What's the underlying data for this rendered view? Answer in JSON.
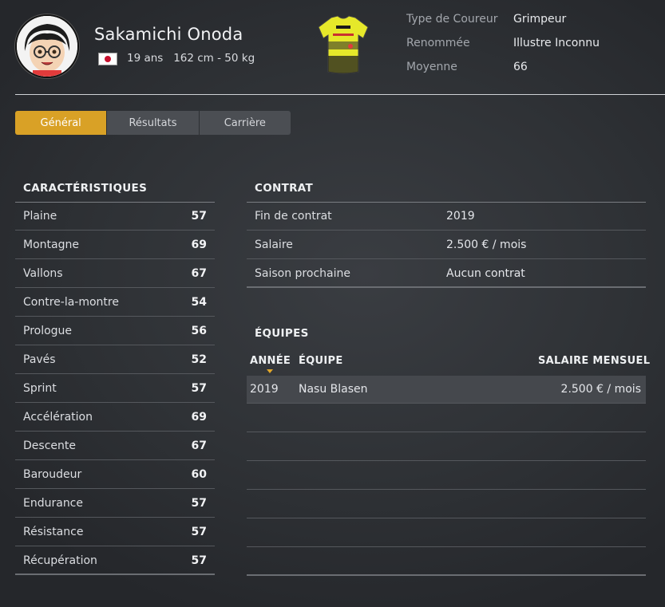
{
  "player": {
    "name": "Sakamichi Onoda",
    "age_height_weight": "19 ans   162 cm - 50 kg",
    "flag_icon": "japan-flag-icon"
  },
  "info": [
    {
      "label": "Type de Coureur",
      "value": "Grimpeur"
    },
    {
      "label": "Renommée",
      "value": "Illustre Inconnu"
    },
    {
      "label": "Moyenne",
      "value": "66"
    }
  ],
  "tabs": [
    {
      "label": "Général",
      "active": true
    },
    {
      "label": "Résultats",
      "active": false
    },
    {
      "label": "Carrière",
      "active": false
    }
  ],
  "characteristics": {
    "title": "CARACTÉRISTIQUES",
    "items": [
      {
        "label": "Plaine",
        "value": "57"
      },
      {
        "label": "Montagne",
        "value": "69"
      },
      {
        "label": "Vallons",
        "value": "67"
      },
      {
        "label": "Contre-la-montre",
        "value": "54"
      },
      {
        "label": "Prologue",
        "value": "56"
      },
      {
        "label": "Pavés",
        "value": "52"
      },
      {
        "label": "Sprint",
        "value": "57"
      },
      {
        "label": "Accélération",
        "value": "69"
      },
      {
        "label": "Descente",
        "value": "67"
      },
      {
        "label": "Baroudeur",
        "value": "60"
      },
      {
        "label": "Endurance",
        "value": "57"
      },
      {
        "label": "Résistance",
        "value": "57"
      },
      {
        "label": "Récupération",
        "value": "57"
      }
    ]
  },
  "contract": {
    "title": "CONTRAT",
    "items": [
      {
        "label": "Fin de contrat",
        "value": "2019"
      },
      {
        "label": "Salaire",
        "value": "2.500 € / mois"
      },
      {
        "label": "Saison prochaine",
        "value": "Aucun contrat"
      }
    ]
  },
  "teams": {
    "title": "ÉQUIPES",
    "columns": {
      "year": "ANNÉE",
      "team": "ÉQUIPE",
      "salary": "SALAIRE MENSUEL"
    },
    "rows": [
      {
        "year": "2019",
        "team": "Nasu Blasen",
        "salary": "2.500 € / mois"
      }
    ]
  },
  "colors": {
    "accent": "#d9a126",
    "jersey_yellow": "#e6e82a"
  }
}
